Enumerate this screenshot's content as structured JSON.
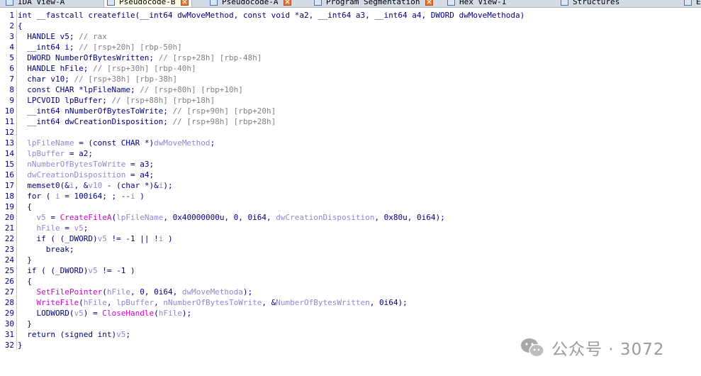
{
  "tabs": [
    {
      "label": "IDA View-A",
      "active": false,
      "closable": false
    },
    {
      "label": "Pseudocode-B",
      "active": true,
      "closable": true
    },
    {
      "label": "Pseudocode-A",
      "active": false,
      "closable": true
    },
    {
      "label": "Program Segmentation",
      "active": false,
      "closable": true
    },
    {
      "label": "Hex View-1",
      "active": false,
      "closable": false
    },
    {
      "label": "Structures",
      "active": false,
      "closable": false
    },
    {
      "label": "En",
      "active": false,
      "closable": false
    }
  ],
  "code_lines": [
    {
      "num": "1",
      "tokens": [
        {
          "t": "int __fastcall createfile(__int64 dwMoveMethod, const void *a2, __int64 a3, __int64 a4, DWORD dwMoveMethoda)",
          "k": "code"
        }
      ]
    },
    {
      "num": "2",
      "tokens": [
        {
          "t": "{",
          "k": "code"
        }
      ]
    },
    {
      "num": "3",
      "tokens": [
        {
          "t": "  HANDLE v5; ",
          "k": "code"
        },
        {
          "t": "// rax",
          "k": "com"
        }
      ]
    },
    {
      "num": "4",
      "tokens": [
        {
          "t": "  __int64 i; ",
          "k": "code"
        },
        {
          "t": "// [rsp+20h] [rbp-50h]",
          "k": "com"
        }
      ]
    },
    {
      "num": "5",
      "tokens": [
        {
          "t": "  DWORD NumberOfBytesWritten; ",
          "k": "code"
        },
        {
          "t": "// [rsp+28h] [rbp-48h]",
          "k": "com"
        }
      ]
    },
    {
      "num": "6",
      "tokens": [
        {
          "t": "  HANDLE hFile; ",
          "k": "code"
        },
        {
          "t": "// [rsp+30h] [rbp-40h]",
          "k": "com"
        }
      ]
    },
    {
      "num": "7",
      "tokens": [
        {
          "t": "  char v10; ",
          "k": "code"
        },
        {
          "t": "// [rsp+38h] [rbp-38h]",
          "k": "com"
        }
      ]
    },
    {
      "num": "8",
      "tokens": [
        {
          "t": "  const CHAR *lpFileName; ",
          "k": "code"
        },
        {
          "t": "// [rsp+80h] [rbp+10h]",
          "k": "com"
        }
      ]
    },
    {
      "num": "9",
      "tokens": [
        {
          "t": "  LPCVOID lpBuffer; ",
          "k": "code"
        },
        {
          "t": "// [rsp+88h] [rbp+18h]",
          "k": "com"
        }
      ]
    },
    {
      "num": "10",
      "tokens": [
        {
          "t": "  __int64 nNumberOfBytesToWrite; ",
          "k": "code"
        },
        {
          "t": "// [rsp+90h] [rbp+20h]",
          "k": "com"
        }
      ]
    },
    {
      "num": "11",
      "tokens": [
        {
          "t": "  __int64 dwCreationDisposition; ",
          "k": "code"
        },
        {
          "t": "// [rsp+98h] [rbp+28h]",
          "k": "com"
        }
      ]
    },
    {
      "num": "12",
      "tokens": []
    },
    {
      "num": "13",
      "tokens": [
        {
          "t": "  lpFileName",
          "k": "var"
        },
        {
          "t": " = (const CHAR *)",
          "k": "code"
        },
        {
          "t": "dwMoveMethod",
          "k": "var"
        },
        {
          "t": ";",
          "k": "code"
        }
      ]
    },
    {
      "num": "14",
      "tokens": [
        {
          "t": "  lpBuffer",
          "k": "var"
        },
        {
          "t": " = a2;",
          "k": "code"
        }
      ]
    },
    {
      "num": "15",
      "tokens": [
        {
          "t": "  nNumberOfBytesToWrite",
          "k": "var"
        },
        {
          "t": " = a3;",
          "k": "code"
        }
      ]
    },
    {
      "num": "16",
      "tokens": [
        {
          "t": "  dwCreationDisposition",
          "k": "var"
        },
        {
          "t": " = a4;",
          "k": "code"
        }
      ]
    },
    {
      "num": "17",
      "tokens": [
        {
          "t": "  memset0(&",
          "k": "code"
        },
        {
          "t": "i",
          "k": "var"
        },
        {
          "t": ", &",
          "k": "code"
        },
        {
          "t": "v10",
          "k": "var"
        },
        {
          "t": " - (char *)&",
          "k": "code"
        },
        {
          "t": "i",
          "k": "var"
        },
        {
          "t": ");",
          "k": "code"
        }
      ]
    },
    {
      "num": "18",
      "tokens": [
        {
          "t": "  for ( ",
          "k": "code"
        },
        {
          "t": "i",
          "k": "var"
        },
        {
          "t": " = 100i64; ; --",
          "k": "code"
        },
        {
          "t": "i",
          "k": "var"
        },
        {
          "t": " )",
          "k": "code"
        }
      ]
    },
    {
      "num": "19",
      "tokens": [
        {
          "t": "  {",
          "k": "code"
        }
      ]
    },
    {
      "num": "20",
      "tokens": [
        {
          "t": "    v5",
          "k": "var"
        },
        {
          "t": " = ",
          "k": "code"
        },
        {
          "t": "CreateFileA",
          "k": "func"
        },
        {
          "t": "(",
          "k": "code"
        },
        {
          "t": "lpFileName",
          "k": "var"
        },
        {
          "t": ", 0x40000000u, 0, 0i64, ",
          "k": "code"
        },
        {
          "t": "dwCreationDisposition",
          "k": "var"
        },
        {
          "t": ", 0x80u, 0i64);",
          "k": "code"
        }
      ]
    },
    {
      "num": "21",
      "tokens": [
        {
          "t": "    hFile",
          "k": "var"
        },
        {
          "t": " = ",
          "k": "code"
        },
        {
          "t": "v5",
          "k": "var"
        },
        {
          "t": ";",
          "k": "code"
        }
      ]
    },
    {
      "num": "22",
      "tokens": [
        {
          "t": "    if ( (_DWORD)",
          "k": "code"
        },
        {
          "t": "v5",
          "k": "var"
        },
        {
          "t": " != -1 || !",
          "k": "code"
        },
        {
          "t": "i",
          "k": "var"
        },
        {
          "t": " )",
          "k": "code"
        }
      ]
    },
    {
      "num": "23",
      "tokens": [
        {
          "t": "      break;",
          "k": "code"
        }
      ]
    },
    {
      "num": "24",
      "tokens": [
        {
          "t": "  }",
          "k": "code"
        }
      ]
    },
    {
      "num": "25",
      "tokens": [
        {
          "t": "  if ( (_DWORD)",
          "k": "code"
        },
        {
          "t": "v5",
          "k": "var"
        },
        {
          "t": " != -1 )",
          "k": "code"
        }
      ]
    },
    {
      "num": "26",
      "tokens": [
        {
          "t": "  {",
          "k": "code"
        }
      ]
    },
    {
      "num": "27",
      "tokens": [
        {
          "t": "    ",
          "k": "code"
        },
        {
          "t": "SetFilePointer",
          "k": "func"
        },
        {
          "t": "(",
          "k": "code"
        },
        {
          "t": "hFile",
          "k": "var"
        },
        {
          "t": ", 0, 0i64, ",
          "k": "code"
        },
        {
          "t": "dwMoveMethoda",
          "k": "var"
        },
        {
          "t": ");",
          "k": "code"
        }
      ]
    },
    {
      "num": "28",
      "tokens": [
        {
          "t": "    ",
          "k": "code"
        },
        {
          "t": "WriteFile",
          "k": "func"
        },
        {
          "t": "(",
          "k": "code"
        },
        {
          "t": "hFile",
          "k": "var"
        },
        {
          "t": ", ",
          "k": "code"
        },
        {
          "t": "lpBuffer",
          "k": "var"
        },
        {
          "t": ", ",
          "k": "code"
        },
        {
          "t": "nNumberOfBytesToWrite",
          "k": "var"
        },
        {
          "t": ", &",
          "k": "code"
        },
        {
          "t": "NumberOfBytesWritten",
          "k": "var"
        },
        {
          "t": ", 0i64);",
          "k": "code"
        }
      ]
    },
    {
      "num": "29",
      "tokens": [
        {
          "t": "    LODWORD(",
          "k": "code"
        },
        {
          "t": "v5",
          "k": "var"
        },
        {
          "t": ") = ",
          "k": "code"
        },
        {
          "t": "CloseHandle",
          "k": "func"
        },
        {
          "t": "(",
          "k": "code"
        },
        {
          "t": "hFile",
          "k": "var"
        },
        {
          "t": ");",
          "k": "code"
        }
      ]
    },
    {
      "num": "30",
      "tokens": [
        {
          "t": "  }",
          "k": "code"
        }
      ]
    },
    {
      "num": "31",
      "tokens": [
        {
          "t": "  return (signed int)",
          "k": "code"
        },
        {
          "t": "v5",
          "k": "var"
        },
        {
          "t": ";",
          "k": "code"
        }
      ]
    },
    {
      "num": "32",
      "tokens": [
        {
          "t": "}",
          "k": "code"
        }
      ]
    }
  ],
  "watermark": {
    "text": "公众号 · 3072",
    "icon": "wechat-icon"
  },
  "colors": {
    "code": "#000080",
    "comment": "#808080",
    "variable": "#8a8ad0",
    "function": "#d000d0",
    "watermark": "#9a9a9a"
  }
}
